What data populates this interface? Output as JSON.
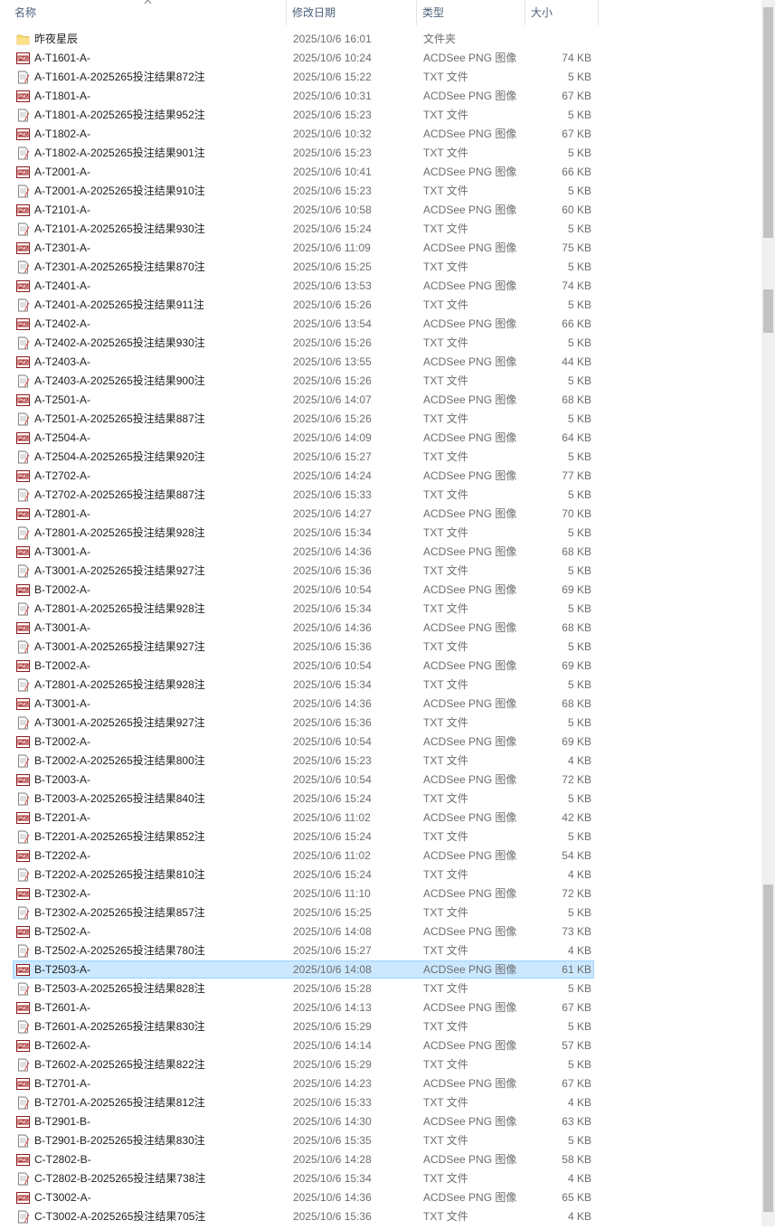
{
  "header": {
    "name": "名称",
    "date": "修改日期",
    "type": "类型",
    "size": "大小"
  },
  "icons": {
    "folder": "folder-icon",
    "png": "png-file-icon",
    "txt": "txt-file-icon"
  },
  "selected_index": 49,
  "scrollbar": {
    "position_fraction": 0.8
  },
  "files": [
    {
      "icon": "folder",
      "name": "昨夜星辰",
      "date": "2025/10/6 16:01",
      "type": "文件夹",
      "size": ""
    },
    {
      "icon": "png",
      "name": "A-T1601-A-",
      "date": "2025/10/6 10:24",
      "type": "ACDSee PNG 图像",
      "size": "74 KB"
    },
    {
      "icon": "txt",
      "name": "A-T1601-A-2025265投注结果872注",
      "date": "2025/10/6 15:22",
      "type": "TXT 文件",
      "size": "5 KB"
    },
    {
      "icon": "png",
      "name": "A-T1801-A-",
      "date": "2025/10/6 10:31",
      "type": "ACDSee PNG 图像",
      "size": "67 KB"
    },
    {
      "icon": "txt",
      "name": "A-T1801-A-2025265投注结果952注",
      "date": "2025/10/6 15:23",
      "type": "TXT 文件",
      "size": "5 KB"
    },
    {
      "icon": "png",
      "name": "A-T1802-A-",
      "date": "2025/10/6 10:32",
      "type": "ACDSee PNG 图像",
      "size": "67 KB"
    },
    {
      "icon": "txt",
      "name": "A-T1802-A-2025265投注结果901注",
      "date": "2025/10/6 15:23",
      "type": "TXT 文件",
      "size": "5 KB"
    },
    {
      "icon": "png",
      "name": "A-T2001-A-",
      "date": "2025/10/6 10:41",
      "type": "ACDSee PNG 图像",
      "size": "66 KB"
    },
    {
      "icon": "txt",
      "name": "A-T2001-A-2025265投注结果910注",
      "date": "2025/10/6 15:23",
      "type": "TXT 文件",
      "size": "5 KB"
    },
    {
      "icon": "png",
      "name": "A-T2101-A-",
      "date": "2025/10/6 10:58",
      "type": "ACDSee PNG 图像",
      "size": "60 KB"
    },
    {
      "icon": "txt",
      "name": "A-T2101-A-2025265投注结果930注",
      "date": "2025/10/6 15:24",
      "type": "TXT 文件",
      "size": "5 KB"
    },
    {
      "icon": "png",
      "name": "A-T2301-A-",
      "date": "2025/10/6 11:09",
      "type": "ACDSee PNG 图像",
      "size": "75 KB"
    },
    {
      "icon": "txt",
      "name": "A-T2301-A-2025265投注结果870注",
      "date": "2025/10/6 15:25",
      "type": "TXT 文件",
      "size": "5 KB"
    },
    {
      "icon": "png",
      "name": "A-T2401-A-",
      "date": "2025/10/6 13:53",
      "type": "ACDSee PNG 图像",
      "size": "74 KB"
    },
    {
      "icon": "txt",
      "name": "A-T2401-A-2025265投注结果911注",
      "date": "2025/10/6 15:26",
      "type": "TXT 文件",
      "size": "5 KB"
    },
    {
      "icon": "png",
      "name": "A-T2402-A-",
      "date": "2025/10/6 13:54",
      "type": "ACDSee PNG 图像",
      "size": "66 KB"
    },
    {
      "icon": "txt",
      "name": "A-T2402-A-2025265投注结果930注",
      "date": "2025/10/6 15:26",
      "type": "TXT 文件",
      "size": "5 KB"
    },
    {
      "icon": "png",
      "name": "A-T2403-A-",
      "date": "2025/10/6 13:55",
      "type": "ACDSee PNG 图像",
      "size": "44 KB"
    },
    {
      "icon": "txt",
      "name": "A-T2403-A-2025265投注结果900注",
      "date": "2025/10/6 15:26",
      "type": "TXT 文件",
      "size": "5 KB"
    },
    {
      "icon": "png",
      "name": "A-T2501-A-",
      "date": "2025/10/6 14:07",
      "type": "ACDSee PNG 图像",
      "size": "68 KB"
    },
    {
      "icon": "txt",
      "name": "A-T2501-A-2025265投注结果887注",
      "date": "2025/10/6 15:26",
      "type": "TXT 文件",
      "size": "5 KB"
    },
    {
      "icon": "png",
      "name": "A-T2504-A-",
      "date": "2025/10/6 14:09",
      "type": "ACDSee PNG 图像",
      "size": "64 KB"
    },
    {
      "icon": "txt",
      "name": "A-T2504-A-2025265投注结果920注",
      "date": "2025/10/6 15:27",
      "type": "TXT 文件",
      "size": "5 KB"
    },
    {
      "icon": "png",
      "name": "A-T2702-A-",
      "date": "2025/10/6 14:24",
      "type": "ACDSee PNG 图像",
      "size": "77 KB"
    },
    {
      "icon": "txt",
      "name": "A-T2702-A-2025265投注结果887注",
      "date": "2025/10/6 15:33",
      "type": "TXT 文件",
      "size": "5 KB"
    },
    {
      "icon": "png",
      "name": "A-T2801-A-",
      "date": "2025/10/6 14:27",
      "type": "ACDSee PNG 图像",
      "size": "70 KB"
    },
    {
      "icon": "txt",
      "name": "A-T2801-A-2025265投注结果928注",
      "date": "2025/10/6 15:34",
      "type": "TXT 文件",
      "size": "5 KB"
    },
    {
      "icon": "png",
      "name": "A-T3001-A-",
      "date": "2025/10/6 14:36",
      "type": "ACDSee PNG 图像",
      "size": "68 KB"
    },
    {
      "icon": "txt",
      "name": "A-T3001-A-2025265投注结果927注",
      "date": "2025/10/6 15:36",
      "type": "TXT 文件",
      "size": "5 KB"
    },
    {
      "icon": "png",
      "name": "B-T2002-A-",
      "date": "2025/10/6 10:54",
      "type": "ACDSee PNG 图像",
      "size": "69 KB"
    },
    {
      "icon": "txt",
      "name": "A-T2801-A-2025265投注结果928注",
      "date": "2025/10/6 15:34",
      "type": "TXT 文件",
      "size": "5 KB"
    },
    {
      "icon": "png",
      "name": "A-T3001-A-",
      "date": "2025/10/6 14:36",
      "type": "ACDSee PNG 图像",
      "size": "68 KB"
    },
    {
      "icon": "txt",
      "name": "A-T3001-A-2025265投注结果927注",
      "date": "2025/10/6 15:36",
      "type": "TXT 文件",
      "size": "5 KB"
    },
    {
      "icon": "png",
      "name": "B-T2002-A-",
      "date": "2025/10/6 10:54",
      "type": "ACDSee PNG 图像",
      "size": "69 KB"
    },
    {
      "icon": "txt",
      "name": "A-T2801-A-2025265投注结果928注",
      "date": "2025/10/6 15:34",
      "type": "TXT 文件",
      "size": "5 KB"
    },
    {
      "icon": "png",
      "name": "A-T3001-A-",
      "date": "2025/10/6 14:36",
      "type": "ACDSee PNG 图像",
      "size": "68 KB"
    },
    {
      "icon": "txt",
      "name": "A-T3001-A-2025265投注结果927注",
      "date": "2025/10/6 15:36",
      "type": "TXT 文件",
      "size": "5 KB"
    },
    {
      "icon": "png",
      "name": "B-T2002-A-",
      "date": "2025/10/6 10:54",
      "type": "ACDSee PNG 图像",
      "size": "69 KB"
    },
    {
      "icon": "txt",
      "name": "B-T2002-A-2025265投注结果800注",
      "date": "2025/10/6 15:23",
      "type": "TXT 文件",
      "size": "4 KB"
    },
    {
      "icon": "png",
      "name": "B-T2003-A-",
      "date": "2025/10/6 10:54",
      "type": "ACDSee PNG 图像",
      "size": "72 KB"
    },
    {
      "icon": "txt",
      "name": "B-T2003-A-2025265投注结果840注",
      "date": "2025/10/6 15:24",
      "type": "TXT 文件",
      "size": "5 KB"
    },
    {
      "icon": "png",
      "name": "B-T2201-A-",
      "date": "2025/10/6 11:02",
      "type": "ACDSee PNG 图像",
      "size": "42 KB"
    },
    {
      "icon": "txt",
      "name": "B-T2201-A-2025265投注结果852注",
      "date": "2025/10/6 15:24",
      "type": "TXT 文件",
      "size": "5 KB"
    },
    {
      "icon": "png",
      "name": "B-T2202-A-",
      "date": "2025/10/6 11:02",
      "type": "ACDSee PNG 图像",
      "size": "54 KB"
    },
    {
      "icon": "txt",
      "name": "B-T2202-A-2025265投注结果810注",
      "date": "2025/10/6 15:24",
      "type": "TXT 文件",
      "size": "4 KB"
    },
    {
      "icon": "png",
      "name": "B-T2302-A-",
      "date": "2025/10/6 11:10",
      "type": "ACDSee PNG 图像",
      "size": "72 KB"
    },
    {
      "icon": "txt",
      "name": "B-T2302-A-2025265投注结果857注",
      "date": "2025/10/6 15:25",
      "type": "TXT 文件",
      "size": "5 KB"
    },
    {
      "icon": "png",
      "name": "B-T2502-A-",
      "date": "2025/10/6 14:08",
      "type": "ACDSee PNG 图像",
      "size": "73 KB"
    },
    {
      "icon": "txt",
      "name": "B-T2502-A-2025265投注结果780注",
      "date": "2025/10/6 15:27",
      "type": "TXT 文件",
      "size": "4 KB"
    },
    {
      "icon": "png",
      "name": "B-T2503-A-",
      "date": "2025/10/6 14:08",
      "type": "ACDSee PNG 图像",
      "size": "61 KB"
    },
    {
      "icon": "txt",
      "name": "B-T2503-A-2025265投注结果828注",
      "date": "2025/10/6 15:28",
      "type": "TXT 文件",
      "size": "5 KB"
    },
    {
      "icon": "png",
      "name": "B-T2601-A-",
      "date": "2025/10/6 14:13",
      "type": "ACDSee PNG 图像",
      "size": "67 KB"
    },
    {
      "icon": "txt",
      "name": "B-T2601-A-2025265投注结果830注",
      "date": "2025/10/6 15:29",
      "type": "TXT 文件",
      "size": "5 KB"
    },
    {
      "icon": "png",
      "name": "B-T2602-A-",
      "date": "2025/10/6 14:14",
      "type": "ACDSee PNG 图像",
      "size": "57 KB"
    },
    {
      "icon": "txt",
      "name": "B-T2602-A-2025265投注结果822注",
      "date": "2025/10/6 15:29",
      "type": "TXT 文件",
      "size": "5 KB"
    },
    {
      "icon": "png",
      "name": "B-T2701-A-",
      "date": "2025/10/6 14:23",
      "type": "ACDSee PNG 图像",
      "size": "67 KB"
    },
    {
      "icon": "txt",
      "name": "B-T2701-A-2025265投注结果812注",
      "date": "2025/10/6 15:33",
      "type": "TXT 文件",
      "size": "4 KB"
    },
    {
      "icon": "png",
      "name": "B-T2901-B-",
      "date": "2025/10/6 14:30",
      "type": "ACDSee PNG 图像",
      "size": "63 KB"
    },
    {
      "icon": "txt",
      "name": "B-T2901-B-2025265投注结果830注",
      "date": "2025/10/6 15:35",
      "type": "TXT 文件",
      "size": "5 KB"
    },
    {
      "icon": "png",
      "name": "C-T2802-B-",
      "date": "2025/10/6 14:28",
      "type": "ACDSee PNG 图像",
      "size": "58 KB"
    },
    {
      "icon": "txt",
      "name": "C-T2802-B-2025265投注结果738注",
      "date": "2025/10/6 15:34",
      "type": "TXT 文件",
      "size": "4 KB"
    },
    {
      "icon": "png",
      "name": "C-T3002-A-",
      "date": "2025/10/6 14:36",
      "type": "ACDSee PNG 图像",
      "size": "65 KB"
    },
    {
      "icon": "txt",
      "name": "C-T3002-A-2025265投注结果705注",
      "date": "2025/10/6 15:36",
      "type": "TXT 文件",
      "size": "4 KB"
    }
  ]
}
